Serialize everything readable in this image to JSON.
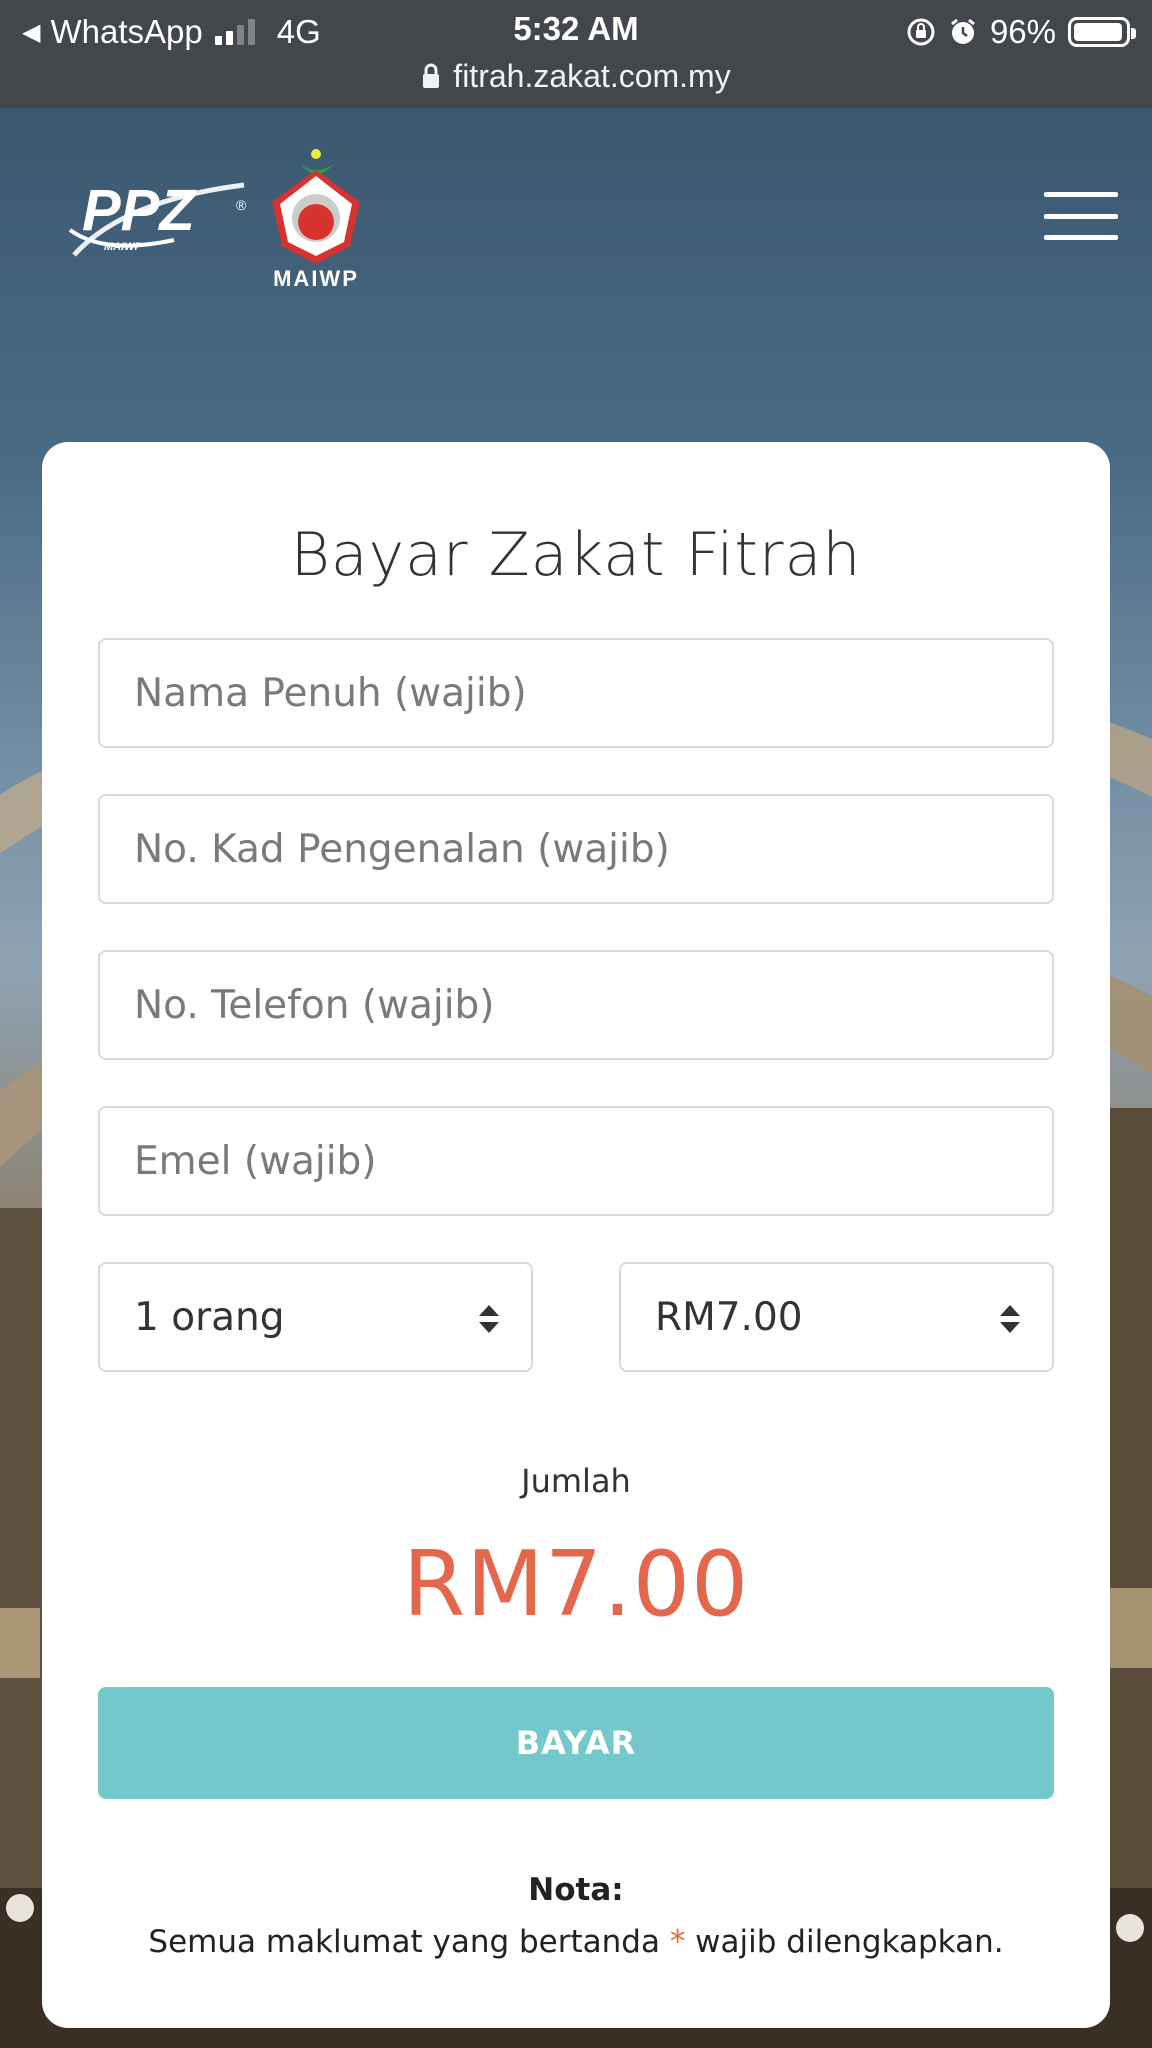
{
  "status_bar": {
    "back_app": "WhatsApp",
    "network": "4G",
    "time": "5:32 AM",
    "battery": "96%",
    "battery_level": 0.96
  },
  "url_bar": {
    "url": "fitrah.zakat.com.my"
  },
  "header": {
    "logo_ppz": "PPZ",
    "logo_ppz_sub": "MAIWP",
    "logo_maiwp": "MAIWP",
    "menu_icon": "hamburger-icon"
  },
  "form": {
    "title": "Bayar Zakat Fitrah",
    "name_placeholder": "Nama Penuh (wajib)",
    "ic_placeholder": "No. Kad Pengenalan (wajib)",
    "phone_placeholder": "No. Telefon (wajib)",
    "email_placeholder": "Emel (wajib)",
    "persons_selected": "1 orang",
    "rate_selected": "RM7.00",
    "total_label": "Jumlah",
    "total_value": "RM7.00",
    "pay_label": "BAYAR",
    "note_title": "Nota:",
    "note_before": "Semua maklumat yang bertanda ",
    "note_asterisk": "*",
    "note_after": " wajib dilengkapkan."
  },
  "colors": {
    "accent_red": "#e4674c",
    "button_teal": "#72c8ca",
    "status_bar": "#43474b"
  }
}
